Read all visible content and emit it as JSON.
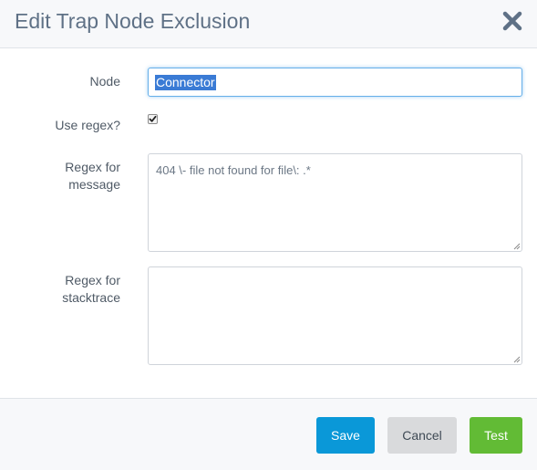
{
  "dialog": {
    "title": "Edit Trap Node Exclusion",
    "close_icon": "close-icon"
  },
  "form": {
    "node_label": "Node",
    "node_value": "Connector",
    "use_regex_label": "Use regex?",
    "use_regex_checked": true,
    "regex_message_label_line1": "Regex for",
    "regex_message_label_line2": "message",
    "regex_message_value": "404 \\- file not found for file\\: .*",
    "regex_stacktrace_label_line1": "Regex for",
    "regex_stacktrace_label_line2": "stacktrace",
    "regex_stacktrace_value": ""
  },
  "footer": {
    "save_label": "Save",
    "cancel_label": "Cancel",
    "test_label": "Test"
  },
  "colors": {
    "save": "#0a98d8",
    "cancel": "#d9dadc",
    "test": "#62bb35",
    "title": "#5f7186",
    "focus_border": "#66afe9"
  }
}
